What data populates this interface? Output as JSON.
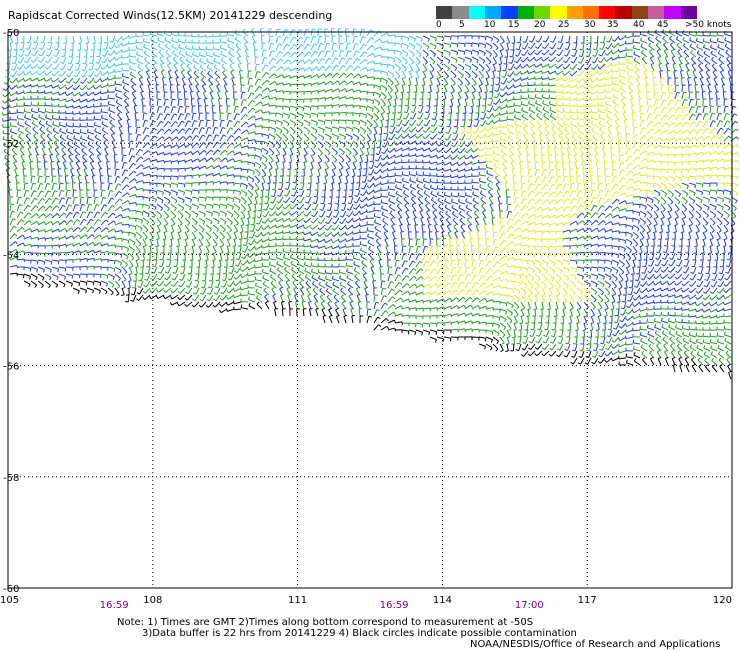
{
  "title": "Rapidscat Corrected Winds(12.5KM) 20141229 descending",
  "legend": {
    "colors": [
      "#404040",
      "#8c8c8c",
      "#00ffff",
      "#00a8ff",
      "#0040ff",
      "#00b000",
      "#6cd800",
      "#ffff00",
      "#ffa000",
      "#ff7000",
      "#ff0000",
      "#b80000",
      "#8b4513",
      "#c060a0",
      "#c000ff",
      "#7000a0"
    ],
    "labels": [
      "0",
      "5",
      "10",
      "15",
      "20",
      "25",
      "30",
      "35",
      "40",
      "45",
      ">50 knots"
    ]
  },
  "axes": {
    "x_ticks": [
      "105",
      "108",
      "111",
      "114",
      "117",
      "120"
    ],
    "y_ticks": [
      "-50",
      "-52",
      "-54",
      "-56",
      "-58",
      "-60"
    ],
    "x_range": [
      105,
      120
    ],
    "y_range": [
      -50,
      -60
    ]
  },
  "times": [
    {
      "label": "16:59",
      "lon": 107.2
    },
    {
      "label": "16:59",
      "lon": 113.0
    },
    {
      "label": "17:00",
      "lon": 115.8
    }
  ],
  "notes": {
    "line1": "Note: 1) Times are GMT 2)Times along bottom correspond to measurement at -50S",
    "line2": "3)Data buffer is 22 hrs from 20141229 4) Black circles indicate possible contamination"
  },
  "credit": "NOAA/NESDIS/Office of Research and Applications",
  "swath": {
    "wind_colors": {
      "calm": "#40c8e8",
      "low": "#2040e0",
      "mid": "#20a020",
      "high": "#e8e820",
      "flag": "#000000"
    }
  }
}
